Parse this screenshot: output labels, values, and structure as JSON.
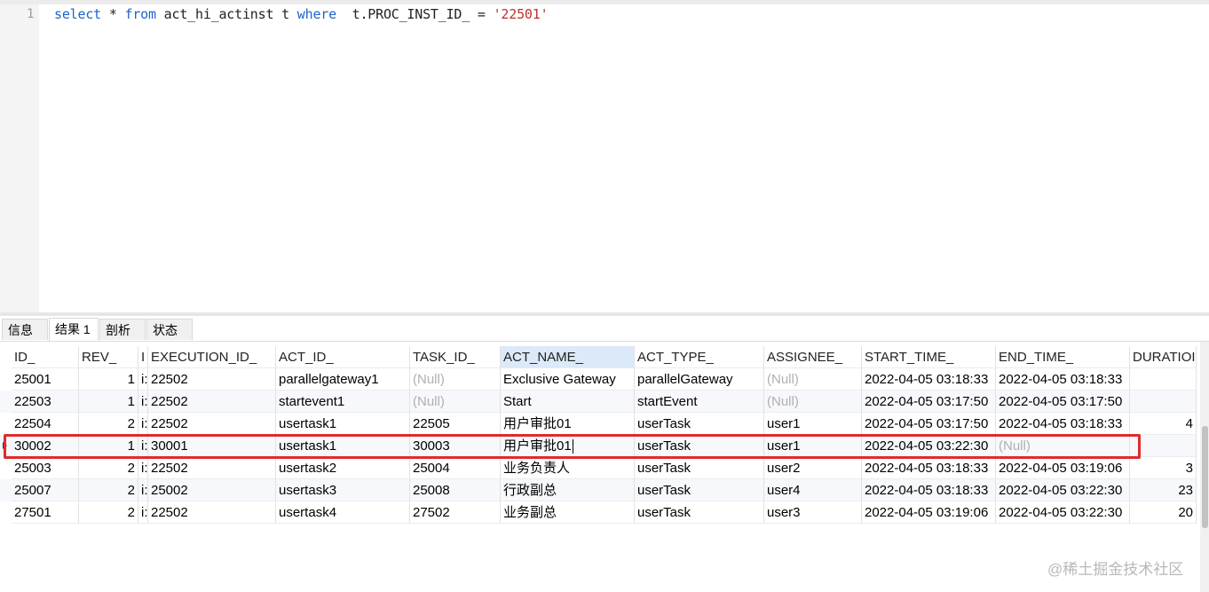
{
  "editor": {
    "line_number": "1",
    "tokens": {
      "t1": "select",
      "t2": " * ",
      "t3": "from",
      "t4": " act_hi_actinst t ",
      "t5": "where",
      "t6": "  t.PROC_INST_ID_ = ",
      "t7": "'22501'"
    }
  },
  "tabs": [
    "信息",
    "结果 1",
    "剖析",
    "状态"
  ],
  "grid": {
    "headers": [
      "ID_",
      "REV_",
      "I",
      "EXECUTION_ID_",
      "ACT_ID_",
      "TASK_ID_",
      "ACT_NAME_",
      "ACT_TYPE_",
      "ASSIGNEE_",
      "START_TIME_",
      "END_TIME_",
      "DURATIOI"
    ],
    "rows": [
      [
        "25001",
        "1",
        "i:",
        "22502",
        "parallelgateway1",
        "(Null)",
        "Exclusive Gateway",
        "parallelGateway",
        "(Null)",
        "2022-04-05 03:18:33",
        "2022-04-05 03:18:33",
        ""
      ],
      [
        "22503",
        "1",
        "i:",
        "22502",
        "startevent1",
        "(Null)",
        "Start",
        "startEvent",
        "(Null)",
        "2022-04-05 03:17:50",
        "2022-04-05 03:17:50",
        ""
      ],
      [
        "22504",
        "2",
        "i:",
        "22502",
        "usertask1",
        "22505",
        "用户审批01",
        "userTask",
        "user1",
        "2022-04-05 03:17:50",
        "2022-04-05 03:18:33",
        "4"
      ],
      [
        "30002",
        "1",
        "i:",
        "30001",
        "usertask1",
        "30003",
        "用户审批01",
        "userTask",
        "user1",
        "2022-04-05 03:22:30",
        "(Null)",
        ""
      ],
      [
        "25003",
        "2",
        "i:",
        "22502",
        "usertask2",
        "25004",
        "业务负责人",
        "userTask",
        "user2",
        "2022-04-05 03:18:33",
        "2022-04-05 03:19:06",
        "3"
      ],
      [
        "25007",
        "2",
        "i:",
        "25002",
        "usertask3",
        "25008",
        "行政副总",
        "userTask",
        "user4",
        "2022-04-05 03:18:33",
        "2022-04-05 03:22:30",
        "23"
      ],
      [
        "27501",
        "2",
        "i:",
        "22502",
        "usertask4",
        "27502",
        "业务副总",
        "userTask",
        "user3",
        "2022-04-05 03:19:06",
        "2022-04-05 03:22:30",
        "20"
      ]
    ]
  },
  "watermark": "@稀土掘金技术社区",
  "colors": {
    "keyword": "#1d63c8",
    "string": "#c0312b",
    "highlight": "#e02b2b",
    "null_text": "#b0b0b0"
  }
}
